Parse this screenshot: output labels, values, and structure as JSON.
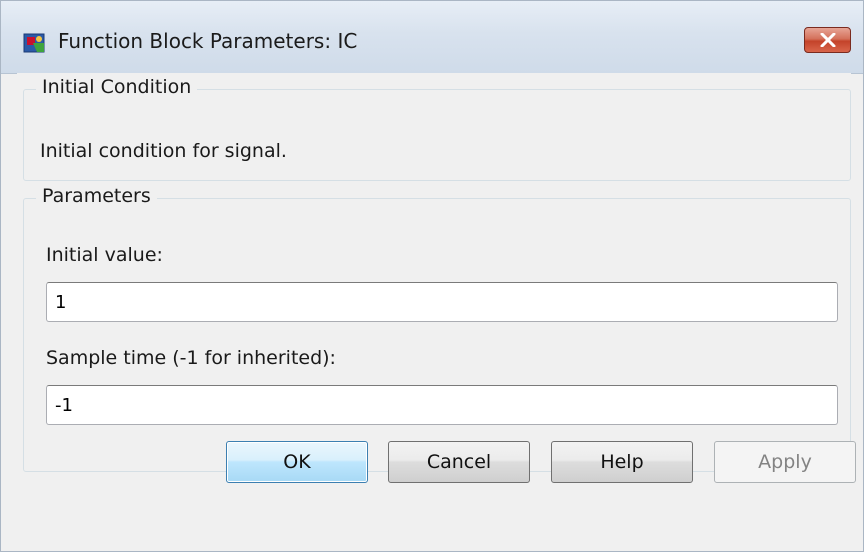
{
  "window": {
    "title": "Function Block Parameters: IC",
    "icon": "simulink-block-icon",
    "close_icon": "close-icon"
  },
  "initial_condition_group": {
    "title": "Initial Condition",
    "description": "Initial condition for signal."
  },
  "parameters_group": {
    "title": "Parameters",
    "initial_value": {
      "label": "Initial value:",
      "value": "1"
    },
    "sample_time": {
      "label": "Sample time (-1 for inherited):",
      "value": "-1"
    }
  },
  "buttons": {
    "ok": "OK",
    "cancel": "Cancel",
    "help": "Help",
    "apply": "Apply"
  },
  "colors": {
    "titlebar": "#d8e2ee",
    "close_button": "#c4432a",
    "default_button_border": "#3c7fb1",
    "disabled_text": "#838383"
  }
}
